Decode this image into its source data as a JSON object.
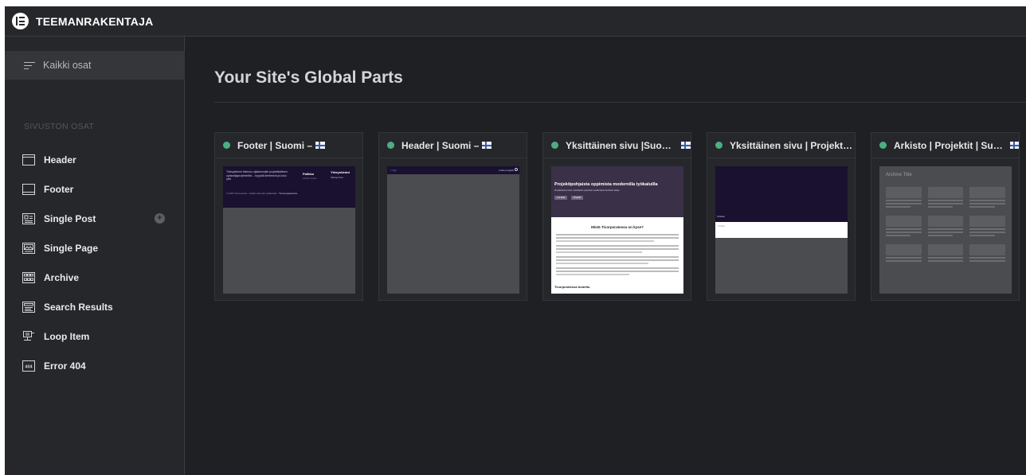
{
  "app": {
    "title": "TEEMANRAKENTAJA"
  },
  "sidebar": {
    "all_parts_label": "Kaikki osat",
    "section_label": "SIVUSTON OSAT",
    "items": [
      {
        "label": "Header",
        "icon": "header-icon"
      },
      {
        "label": "Footer",
        "icon": "footer-icon"
      },
      {
        "label": "Single Post",
        "icon": "single-post-icon"
      },
      {
        "label": "Single Page",
        "icon": "single-page-icon"
      },
      {
        "label": "Archive",
        "icon": "archive-icon"
      },
      {
        "label": "Search Results",
        "icon": "search-results-icon"
      },
      {
        "label": "Loop Item",
        "icon": "loop-item-icon"
      },
      {
        "label": "Error 404",
        "icon": "error-404-icon"
      }
    ],
    "add_symbol": "+"
  },
  "main": {
    "title": "Your Site's Global Parts",
    "cards": [
      {
        "title": "Footer | Suomi –",
        "status_color": "#4caf80"
      },
      {
        "title": "Header | Suomi –",
        "status_color": "#4caf80"
      },
      {
        "title": "Yksittäinen sivu |Suomi –",
        "status_color": "#4caf80"
      },
      {
        "title": "Yksittäinen sivu | Projektit –",
        "status_color": "#4caf80"
      },
      {
        "title": "Arkisto | Projektit | Suomi –",
        "status_color": "#4caf80"
      }
    ]
  },
  "thumbs": {
    "footer": {
      "text1": "Tiivisysteemi tekevuu sijaitsemalle projektitaitteen opiskelijaprojekteihin – hyppää kiertelevä ja koko yksi",
      "heading1": "Palikka",
      "heading2": "Yhteystiedot",
      "sub1": "xxxxxx xxxxx",
      "sub2": "Tiivisys Koe",
      "copyright": "© 2024 Ticorporatio • Kaikki oikeudet pidätetään",
      "link": "Tietosuojaseloste"
    },
    "header": {
      "logo_text": "Logo",
      "link": "Linkki projektit"
    },
    "single": {
      "hero_title": "Projektipohjaista oppimista modernilla työkaluilla",
      "hero_sub": "Projektiopetus tukee opiskelijoita oppimaan työelämässä tarvittavia taitoja",
      "btn1": "Lue lisää",
      "btn2": "Projektit",
      "section_title": "Mistä Ticorporatessa on kyse?",
      "footer_text": "Ticorporatessa tuotettu"
    },
    "project": {
      "label": "Otsikko",
      "field": "Sisältö"
    },
    "archive": {
      "title": "Archive Title"
    }
  }
}
